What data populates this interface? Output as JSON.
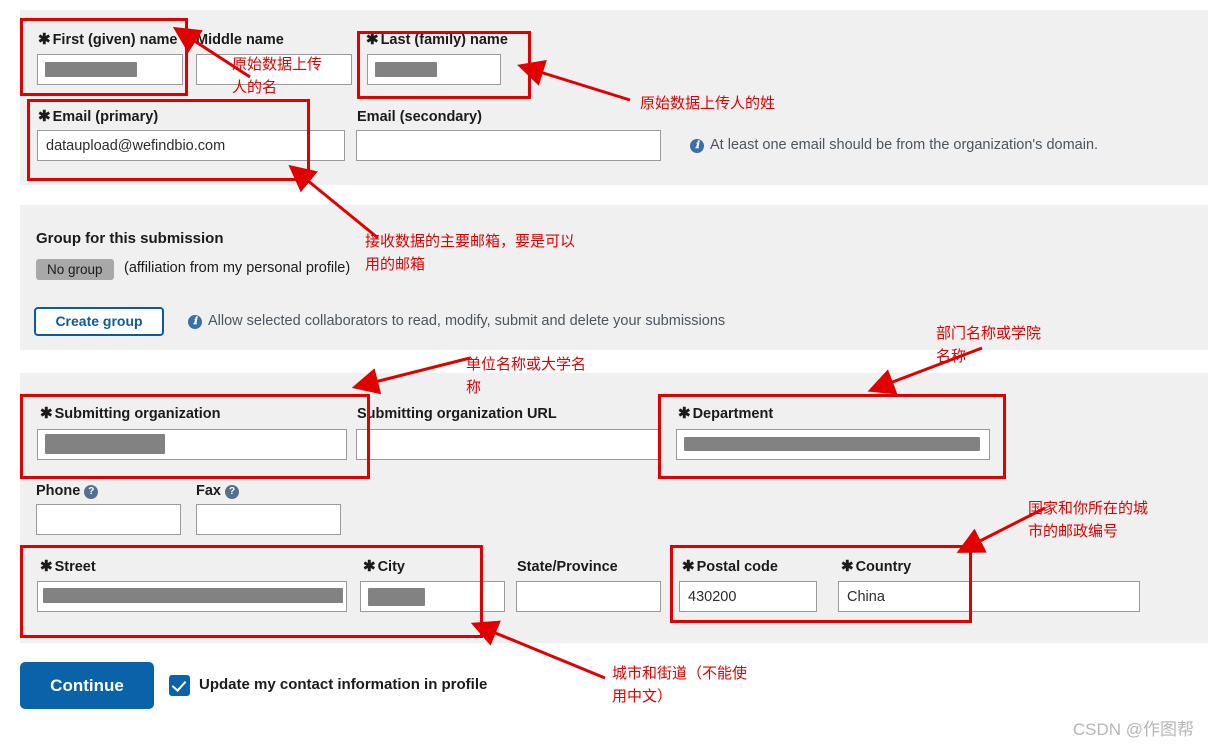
{
  "panels": {
    "contact": {
      "name": "contact-panel"
    },
    "group": {
      "name": "group-panel"
    },
    "organization": {
      "name": "organization-panel"
    }
  },
  "colors": {
    "panel_bg": "#f0f0f0",
    "page_bg": "#ffffff",
    "primary_button": "#0a62a9",
    "outline_button": "#0b5c9a",
    "annotation_red": "#e30000",
    "redaction_grey": "#828282",
    "input_border": "#9a9a9a"
  },
  "contact": {
    "first_name": {
      "label": "First (given) name",
      "required": true,
      "value": "",
      "redacted": true
    },
    "middle_name": {
      "label": "Middle name",
      "required": false,
      "value": ""
    },
    "last_name": {
      "label": "Last (family) name",
      "required": true,
      "value": "",
      "redacted": true
    },
    "email_primary": {
      "label": "Email (primary)",
      "required": true,
      "value": "dataupload@wefindbio.com"
    },
    "email_secondary": {
      "label": "Email (secondary)",
      "required": false,
      "value": ""
    },
    "email_note": "At least one email should be from the organization's domain."
  },
  "group": {
    "title": "Group for this submission",
    "chip": "No group",
    "affiliation_text": "(affiliation from my personal profile)",
    "create_button": "Create group",
    "create_note": "Allow selected collaborators to read, modify, submit and delete your submissions"
  },
  "organization": {
    "submitting_organization": {
      "label": "Submitting organization",
      "required": true,
      "value": "",
      "redacted": true
    },
    "submitting_organization_url": {
      "label": "Submitting organization URL",
      "required": false,
      "value": ""
    },
    "department": {
      "label": "Department",
      "required": true,
      "value": "",
      "redacted": true
    },
    "phone": {
      "label": "Phone",
      "required": false,
      "value": "",
      "help": true
    },
    "fax": {
      "label": "Fax",
      "required": false,
      "value": "",
      "help": true
    },
    "street": {
      "label": "Street",
      "required": true,
      "value": "",
      "redacted": true
    },
    "city": {
      "label": "City",
      "required": true,
      "value": "",
      "redacted": true
    },
    "state_province": {
      "label": "State/Province",
      "required": false,
      "value": ""
    },
    "postal_code": {
      "label": "Postal code",
      "required": true,
      "value": "430200"
    },
    "country": {
      "label": "Country",
      "required": true,
      "value": "China"
    }
  },
  "footer": {
    "continue_button": "Continue",
    "update_checkbox_label": "Update my contact information in profile",
    "update_checkbox_checked": true
  },
  "annotations": [
    {
      "id": "first-name-note",
      "text": "原始数据上传\n人的名"
    },
    {
      "id": "last-name-note",
      "text": "原始数据上传人的姓"
    },
    {
      "id": "email-note",
      "text": "接收数据的主要邮箱，要是可以\n用的邮箱"
    },
    {
      "id": "organization-note",
      "text": "单位名称或大学名\n称"
    },
    {
      "id": "department-note",
      "text": "部门名称或学院\n名称"
    },
    {
      "id": "postal-country-note",
      "text": "国家和你所在的城\n市的邮政编号"
    },
    {
      "id": "street-city-note",
      "text": "城市和街道（不能使\n用中文）"
    }
  ],
  "watermark": "CSDN @作图帮",
  "icons": {
    "info": "ℹ",
    "help": "?",
    "required_star": "✱"
  }
}
